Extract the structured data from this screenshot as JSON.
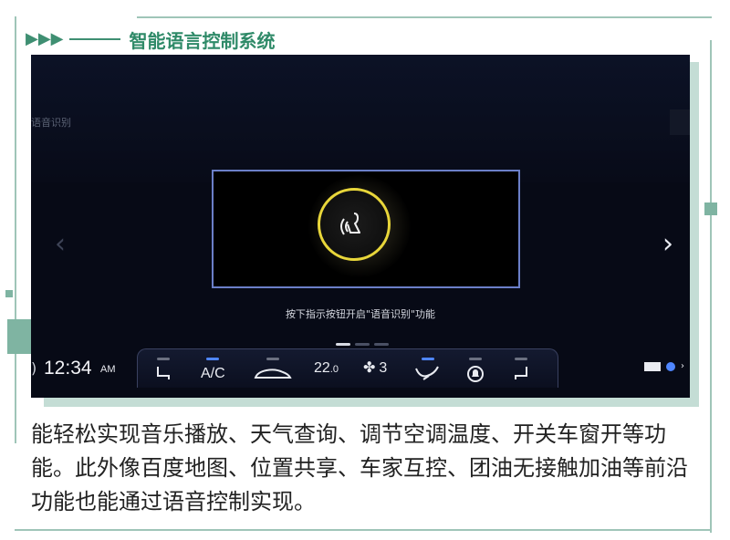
{
  "header": {
    "arrows": "▶▶▶",
    "title": "智能语言控制系统"
  },
  "screen": {
    "top_label": "语音识别",
    "nav_left_icon": "chevron-left-icon",
    "nav_right_icon": "chevron-right-icon",
    "voice_hint": "按下指示按钮开启\"语音识别\"功能",
    "page_dots": 3,
    "active_dot": 0
  },
  "bottom_bar": {
    "time": "12:34",
    "ampm": "AM",
    "controls": [
      {
        "name": "seat-heat-left",
        "icon": "seat-icon",
        "label": "",
        "indicator": "off"
      },
      {
        "name": "ac",
        "icon": "",
        "label": "A/C",
        "indicator": "on"
      },
      {
        "name": "recirculation",
        "icon": "car-icon",
        "label": "",
        "indicator": "off"
      },
      {
        "name": "temperature",
        "icon": "",
        "label": "22.0",
        "indicator": "none"
      },
      {
        "name": "fan",
        "icon": "fan-icon",
        "label": "3",
        "indicator": "none"
      },
      {
        "name": "defrost",
        "icon": "airflow-icon",
        "label": "",
        "indicator": "on"
      },
      {
        "name": "auto",
        "icon": "bell-icon",
        "label": "",
        "indicator": "off"
      },
      {
        "name": "seat-heat-right",
        "icon": "seat-icon",
        "label": "",
        "indicator": "off"
      }
    ],
    "temperature_value": "22",
    "temperature_decimal": ".0",
    "fan_level": "3"
  },
  "caption": "能轻松实现音乐播放、天气查询、调节空调温度、开关车窗开等功能。此外像百度地图、位置共享、车家互控、团油无接触加油等前沿功能也能通过语音控制实现。",
  "colors": {
    "accent_green": "#2f8a68",
    "mic_ring": "#e8d63a",
    "panel_border": "#6b7fc8",
    "indicator_on": "#4f86ff"
  }
}
